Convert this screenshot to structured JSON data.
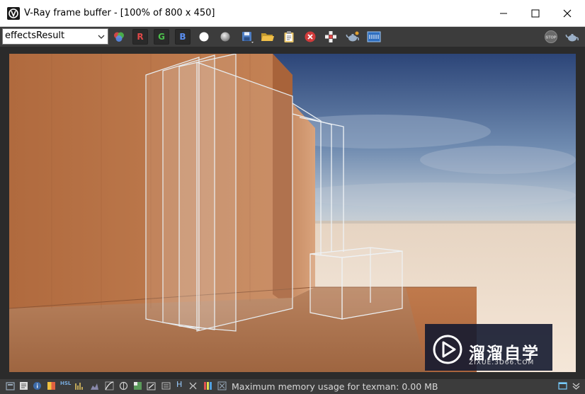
{
  "window": {
    "title": "V-Ray frame buffer - [100% of 800 x 450]",
    "minimize_glyph": "—",
    "maximize_glyph": "☐",
    "close_glyph": "✕"
  },
  "toolbar": {
    "channel_value": "effectsResult",
    "channel_r": "R",
    "channel_g": "G",
    "channel_b": "B",
    "stop_label": "STOP"
  },
  "status": {
    "text": "Maximum memory usage for texman: 0.00 MB",
    "hsl_label": "HSL",
    "h_label": "H"
  },
  "watermark": {
    "title": "溜溜自学",
    "subtitle": "ZIXUE.3D66.COM"
  },
  "colors": {
    "titlebar": "#ffffff",
    "toolbar": "#3c3c3c",
    "channel_r": "#e04848",
    "channel_g": "#4cc04c",
    "channel_b": "#5a8ef0",
    "watermark_bg": "#141a30"
  }
}
